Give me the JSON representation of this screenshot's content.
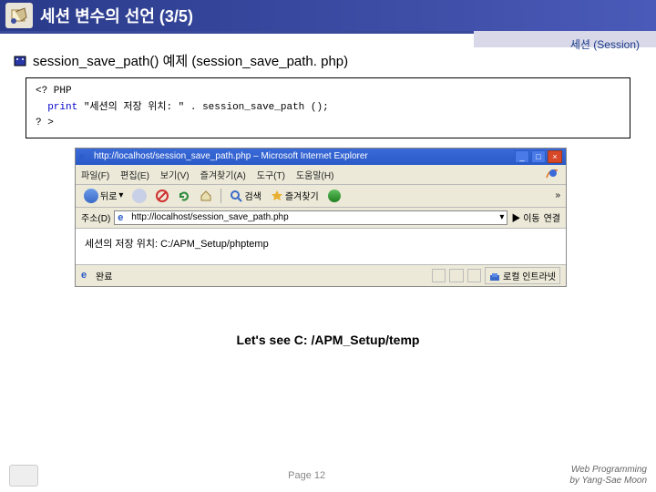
{
  "header": {
    "title": "세션 변수의 선언 (3/5)",
    "session_label": "세션 (Session)"
  },
  "section": {
    "title_func": "session_save_path()",
    "title_rest": " 예제 (session_save_path. php)"
  },
  "code": {
    "l1": "<? PHP",
    "l2_kw": "print",
    "l2_rest": " \"세션의 저장 위치: \" . session_save_path ();",
    "l3": "? >"
  },
  "browser": {
    "title": "http://localhost/session_save_path.php – Microsoft Internet Explorer",
    "menu": {
      "file": "파일(F)",
      "edit": "편집(E)",
      "view": "보기(V)",
      "fav": "즐겨찾기(A)",
      "tools": "도구(T)",
      "help": "도움말(H)"
    },
    "tb": {
      "back": "뒤로",
      "search": "검색",
      "fav": "즐겨찾기"
    },
    "addr": {
      "label": "주소(D)",
      "url": "http://localhost/session_save_path.php",
      "go": "이동",
      "links": "연결"
    },
    "content": "세션의 저장 위치: C:/APM_Setup/phptemp",
    "status": {
      "done": "완료",
      "zone": "로컬 인트라넷"
    }
  },
  "lets_see": "Let's see C: /APM_Setup/temp",
  "footer": {
    "page": "Page 12",
    "credit1": "Web Programming",
    "credit2": "by Yang-Sae Moon"
  }
}
